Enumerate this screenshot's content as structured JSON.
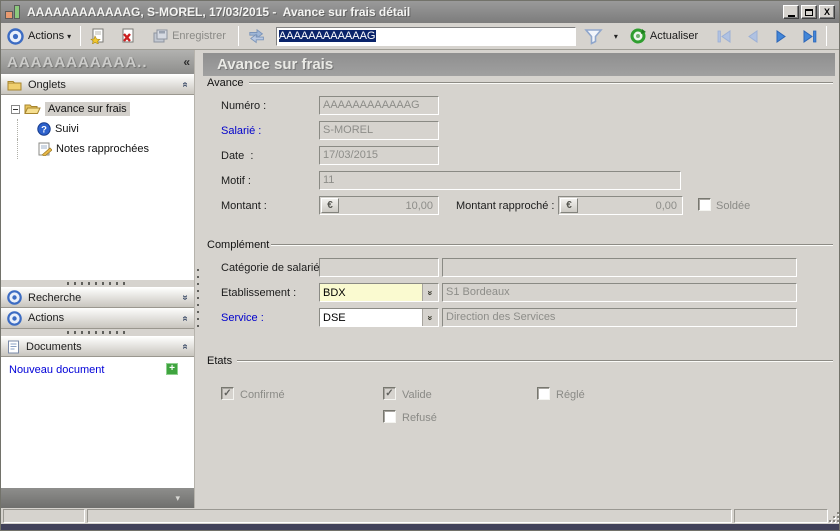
{
  "window": {
    "title": "AAAAAAAAAAAAG, S-MOREL, 17/03/2015 -  Avance sur frais détail"
  },
  "toolbar": {
    "actions_label": "Actions",
    "enregistrer_label": "Enregistrer",
    "record_field_value": "AAAAAAAAAAAAG",
    "actualiser_label": "Actualiser"
  },
  "sidebar": {
    "header_title": "AAAAAAAAAAA..",
    "panels": {
      "onglets": "Onglets",
      "recherche": "Recherche",
      "actions": "Actions",
      "documents": "Documents"
    },
    "tree": {
      "root": "Avance sur frais",
      "items": [
        {
          "label": "Suivi",
          "icon": "help-icon"
        },
        {
          "label": "Notes rapprochées",
          "icon": "note-icon"
        }
      ]
    },
    "nouveau_document": "Nouveau document"
  },
  "main": {
    "header_title": "Avance sur frais",
    "avance": {
      "label": "Avance",
      "numero_label": "Numéro :",
      "numero_value": "AAAAAAAAAAAAG",
      "salarie_label": "Salarié :",
      "salarie_value": "S-MOREL",
      "date_label": "Date  :",
      "date_value": "17/03/2015",
      "motif_label": "Motif :",
      "motif_value": "11",
      "montant_label": "Montant :",
      "currency": "€",
      "montant_value": "10,00",
      "montant_rapproche_label": "Montant rapproché :",
      "montant_rapproche_value": "0,00",
      "soldee_label": "Soldée",
      "soldee_checked": false
    },
    "complement": {
      "label": "Complément",
      "categorie_label": "Catégorie de salarié",
      "categorie_code": "",
      "categorie_libelle": "",
      "etablissement_label": "Etablissement :",
      "etablissement_code": "BDX",
      "etablissement_libelle": "S1 Bordeaux",
      "service_label": "Service :",
      "service_code": "DSE",
      "service_libelle": "Direction des Services"
    },
    "etats": {
      "label": "Etats",
      "confirme_label": "Confirmé",
      "confirme_checked": true,
      "valide_label": "Valide",
      "valide_checked": true,
      "regle_label": "Réglé",
      "regle_checked": false,
      "refuse_label": "Refusé",
      "refuse_checked": false
    }
  },
  "statusbar": {
    "cell1": "",
    "cell2": "",
    "cell3": ""
  }
}
